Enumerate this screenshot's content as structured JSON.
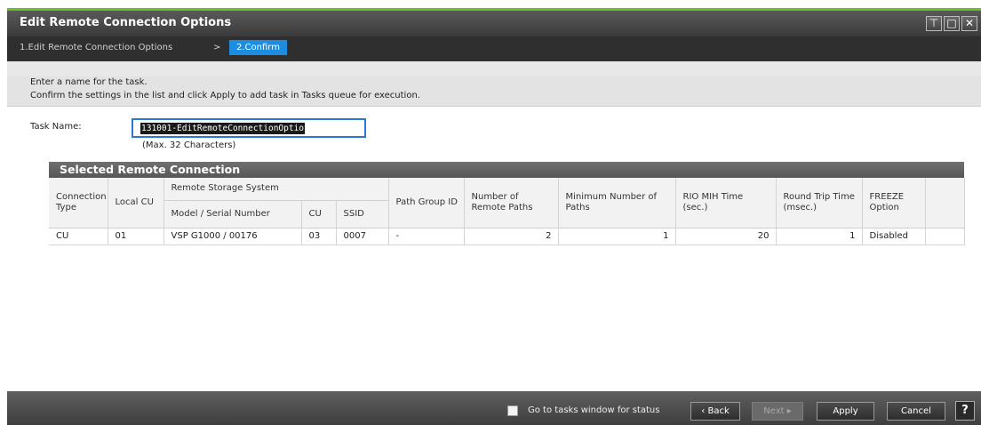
{
  "window": {
    "title": "Edit Remote Connection Options"
  },
  "steps": {
    "step1": "1.Edit Remote Connection Options",
    "separator": ">",
    "step2": "2.Confirm"
  },
  "instructions": {
    "line1": "Enter a name for the task.",
    "line2": "Confirm the settings in the list and click Apply to add task in Tasks queue for execution."
  },
  "task": {
    "label": "Task Name:",
    "value": "131001-EditRemoteConnectionOptio",
    "hint": "(Max. 32 Characters)"
  },
  "section": {
    "title": "Selected Remote Connection"
  },
  "table": {
    "headers": {
      "connection_type": "Connection Type",
      "local_cu": "Local CU",
      "remote_storage": "Remote Storage System",
      "model_serial": "Model / Serial Number",
      "cu": "CU",
      "ssid": "SSID",
      "path_group": "Path Group ID",
      "num_paths": "Number of Remote Paths",
      "min_paths": "Minimum Number of Paths",
      "rio": "RIO MIH Time (sec.)",
      "round_trip": "Round Trip Time (msec.)",
      "freeze": "FREEZE Option"
    },
    "rows": [
      {
        "connection_type": "CU",
        "local_cu": "01",
        "model_serial": "VSP G1000 / 00176",
        "cu": "03",
        "ssid": "0007",
        "path_group": "-",
        "num_paths": "2",
        "min_paths": "1",
        "rio": "20",
        "round_trip": "1",
        "freeze": "Disabled"
      }
    ]
  },
  "footer": {
    "checkbox_label": "Go to tasks window for status",
    "back": "Back",
    "next": "Next",
    "apply": "Apply",
    "cancel": "Cancel",
    "help": "?"
  }
}
